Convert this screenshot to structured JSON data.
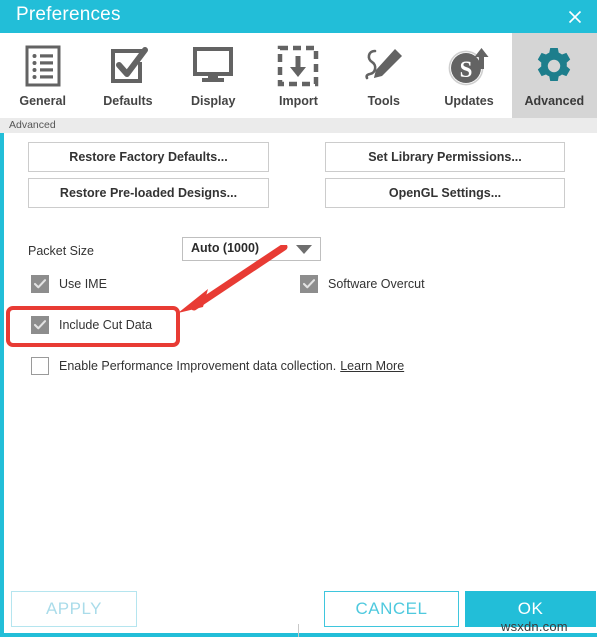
{
  "window": {
    "title": "Preferences",
    "close_icon": "close-icon",
    "accent_color": "#22bed8",
    "selected_tab_bg": "#d5d5d5"
  },
  "tabs": [
    {
      "label": "General",
      "icon": "list-icon",
      "selected": false
    },
    {
      "label": "Defaults",
      "icon": "checkbox-check-icon",
      "selected": false
    },
    {
      "label": "Display",
      "icon": "monitor-icon",
      "selected": false
    },
    {
      "label": "Import",
      "icon": "import-download-icon",
      "selected": false
    },
    {
      "label": "Tools",
      "icon": "pencil-icon",
      "selected": false
    },
    {
      "label": "Updates",
      "icon": "s-upload-icon",
      "selected": false
    },
    {
      "label": "Advanced",
      "icon": "gear-icon",
      "selected": true
    }
  ],
  "breadcrumb": "Advanced",
  "panel": {
    "buttons": [
      {
        "id": "restore-factory-defaults",
        "label": "Restore Factory Defaults..."
      },
      {
        "id": "restore-preloaded-designs",
        "label": "Restore Pre-loaded Designs..."
      },
      {
        "id": "set-library-permissions",
        "label": "Set Library Permissions..."
      },
      {
        "id": "opengl-settings",
        "label": "OpenGL Settings..."
      }
    ],
    "packet_size": {
      "label": "Packet Size",
      "value": "Auto (1000)",
      "arrow_icon": "chevron-down-icon"
    },
    "checkboxes": [
      {
        "id": "use-ime",
        "label": "Use IME",
        "checked": true
      },
      {
        "id": "software-overcut",
        "label": "Software Overcut",
        "checked": true
      },
      {
        "id": "include-cut-data",
        "label": "Include Cut Data",
        "checked": true
      },
      {
        "id": "enable-performance",
        "label": "Enable Performance Improvement data collection.",
        "checked": false,
        "link": "Learn More"
      }
    ]
  },
  "footer": {
    "apply": "APPLY",
    "cancel": "CANCEL",
    "ok": "OK"
  },
  "annotations": {
    "highlight_color": "#e83b34",
    "highlight_target": "include-cut-data",
    "arrow_color": "#e83b34"
  },
  "watermark": "wsxdn.com"
}
